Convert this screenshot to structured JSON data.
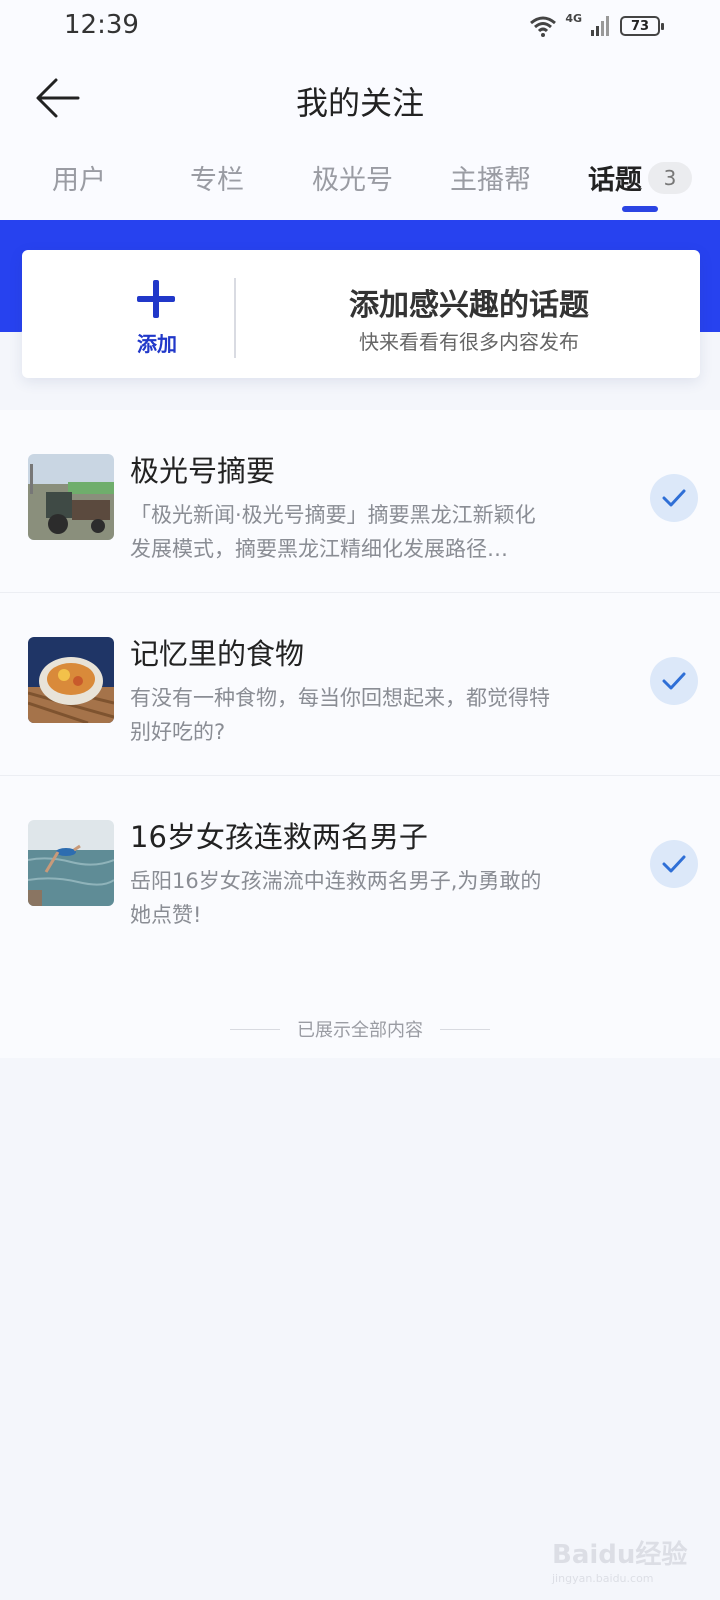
{
  "status_bar": {
    "time": "12:39",
    "network": "4G",
    "battery": "73"
  },
  "header": {
    "title": "我的关注"
  },
  "tabs": [
    {
      "label": "用户",
      "active": false
    },
    {
      "label": "专栏",
      "active": false
    },
    {
      "label": "极光号",
      "active": false
    },
    {
      "label": "主播帮",
      "active": false
    },
    {
      "label": "话题",
      "active": true,
      "badge": "3"
    }
  ],
  "add_card": {
    "add_label": "添加",
    "title": "添加感兴趣的话题",
    "subtitle": "快来看看有很多内容发布"
  },
  "topics": [
    {
      "title": "极光号摘要",
      "desc": "「极光新闻·极光号摘要」摘要黑龙江新颖化发展模式，摘要黑龙江精细化发展路径…",
      "followed": true,
      "thumb": "tractor-field-photo"
    },
    {
      "title": "记忆里的食物",
      "desc": "有没有一种食物，每当你回想起来，都觉得特别好吃的?",
      "followed": true,
      "thumb": "noodle-bowl-photo"
    },
    {
      "title": "16岁女孩连救两名男子",
      "desc": "岳阳16岁女孩湍流中连救两名男子,为勇敢的她点赞!",
      "followed": true,
      "thumb": "diving-into-river-photo"
    }
  ],
  "end_text": "已展示全部内容",
  "watermark": {
    "logo_text": "Baidu经验",
    "url": "jingyan.baidu.com"
  },
  "colors": {
    "accent": "#2742ef",
    "tab_indicator": "#2b44e3",
    "check_bg": "#dce8f9",
    "check_mark": "#2f6fd6"
  }
}
